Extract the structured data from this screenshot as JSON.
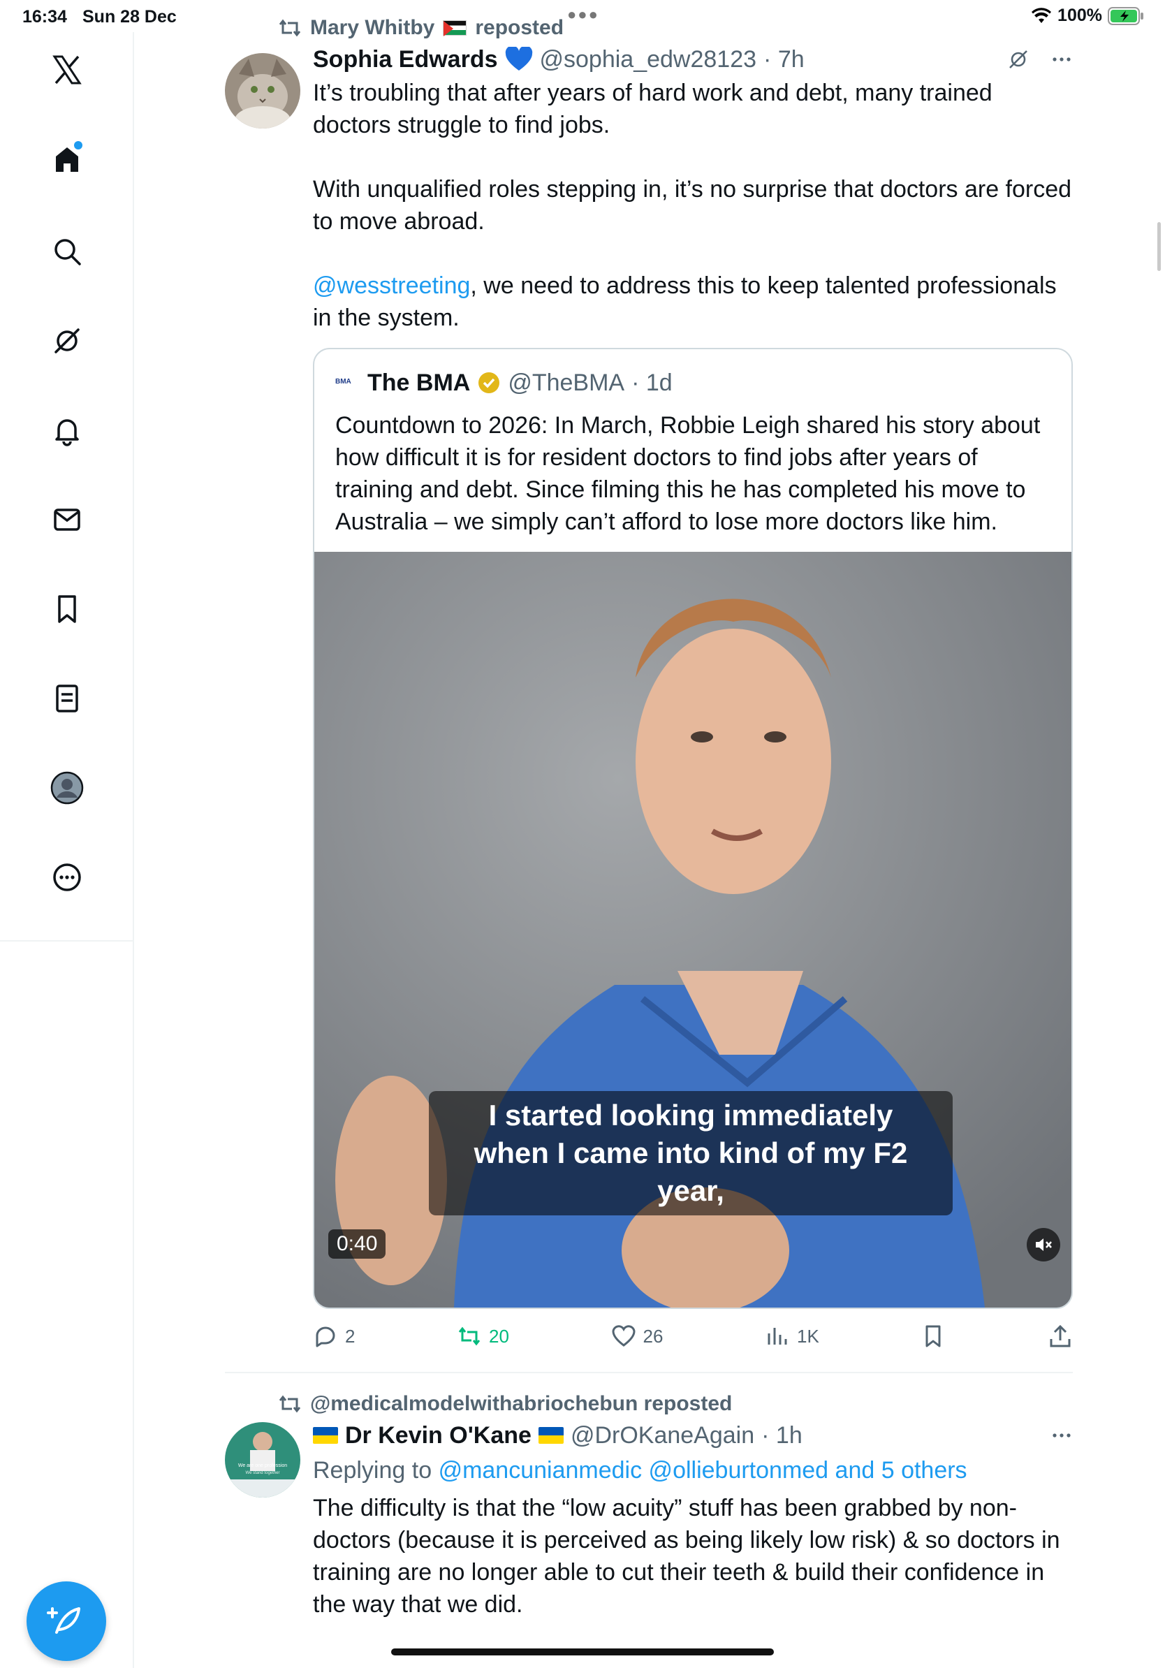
{
  "status_bar": {
    "time": "16:34",
    "date": "Sun 28 Dec",
    "battery": "100%"
  },
  "sidebar": {
    "items": [
      "x-logo-icon",
      "home-icon",
      "search-icon",
      "grok-icon",
      "notifications-icon",
      "messages-icon",
      "bookmarks-icon",
      "lists-icon",
      "profile-icon",
      "more-icon"
    ]
  },
  "tweet1": {
    "reposted_by": "Mary Whitby",
    "reposted_suffix": "reposted",
    "name": "Sophia Edwards",
    "handle": "@sophia_edw28123",
    "time": "· 7h",
    "text_1": "It’s troubling that after years of hard work and debt, many trained doctors struggle to find jobs.",
    "text_2": "With unqualified roles stepping in, it’s no surprise that doctors are forced to move abroad.",
    "mention": "@wesstreeting",
    "text_3_rest": ", we need to address this to keep talented professionals in the system.",
    "quote": {
      "logo": "BMA",
      "name": "The BMA",
      "handle": "@TheBMA",
      "time": "· 1d",
      "text": "Countdown to 2026: In March, Robbie Leigh shared his story about how difficult it is for resident doctors to find jobs after years of training and debt. Since filming this he has completed his move to Australia – we simply can’t afford to lose more doctors like him.",
      "caption_line1": "I started looking immediately",
      "caption_line2": "when I came into kind of my F2 year,",
      "duration": "0:40"
    },
    "stats": {
      "replies": "2",
      "reposts": "20",
      "likes": "26",
      "views": "1K"
    }
  },
  "tweet2": {
    "reposted_by": "@medicalmodelwithabriochebun reposted",
    "name": "Dr Kevin O'Kane",
    "handle": "@DrOKaneAgain",
    "time": "· 1h",
    "replying_prefix": "Replying to",
    "replying_to": "@mancunianmedic @ollieburtonmed and 5 others",
    "text": "The difficulty is that the “low acuity” stuff has been grabbed by non-doctors (because it is perceived as being likely low risk) & so doctors in training are no longer able to cut their teeth & build their confidence in the way that we did.",
    "avatar_text_1": "We are one profession",
    "avatar_text_2": "We stand together"
  },
  "colors": {
    "accent": "#1d9bf0",
    "repost_green": "#00ba7c",
    "muted": "#536471"
  }
}
